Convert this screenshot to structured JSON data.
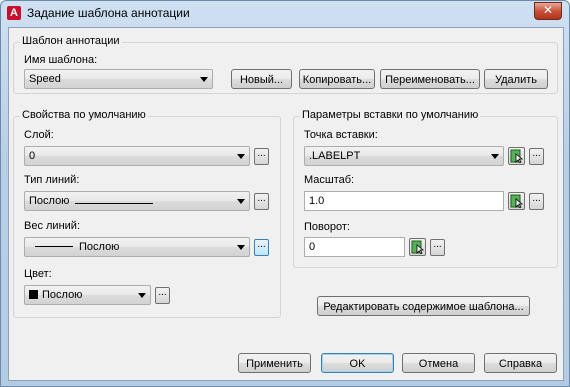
{
  "window": {
    "title": "Задание шаблона аннотации",
    "close_label": "✕"
  },
  "template_group": {
    "label": "Шаблон аннотации",
    "name_label": "Имя шаблона:",
    "name_value": "Speed",
    "buttons": {
      "new": "Новый...",
      "copy": "Копировать...",
      "rename": "Переименовать...",
      "delete": "Удалить"
    }
  },
  "defaults": {
    "label": "Свойства по умолчанию",
    "layer_label": "Слой:",
    "layer_value": "0",
    "linetype_label": "Тип линий:",
    "linetype_value": "Послою",
    "lineweight_label": "Вес линий:",
    "lineweight_value": "Послою",
    "color_label": "Цвет:",
    "color_value": "Послою",
    "color_hex": "#000000"
  },
  "insertion": {
    "label": "Параметры вставки по умолчанию",
    "point_label": "Точка вставки:",
    "point_value": ".LABELPT",
    "scale_label": "Масштаб:",
    "scale_value": "1.0",
    "rotation_label": "Поворот:",
    "rotation_value": "0"
  },
  "edit_button": "Редактировать содержимое шаблона...",
  "footer": {
    "apply": "Применить",
    "ok": "OK",
    "cancel": "Отмена",
    "help": "Справка"
  },
  "dots_label": "..."
}
